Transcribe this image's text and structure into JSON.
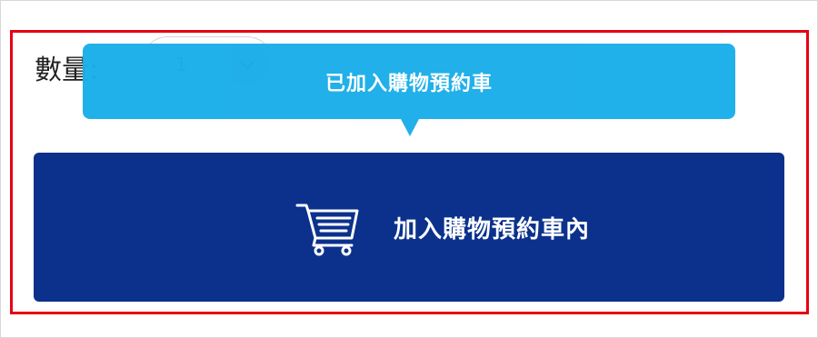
{
  "quantity": {
    "label": "數量:",
    "selected_value": "1",
    "arrow_icon": "chevron-down-icon"
  },
  "tooltip": {
    "message": "已加入購物預約車"
  },
  "cart_button": {
    "label": "加入購物預約車內",
    "icon": "shopping-cart-icon"
  },
  "colors": {
    "highlight_border": "#e60012",
    "tooltip_bg": "#1aaee9",
    "button_bg": "#0b318c",
    "text_white": "#ffffff"
  }
}
